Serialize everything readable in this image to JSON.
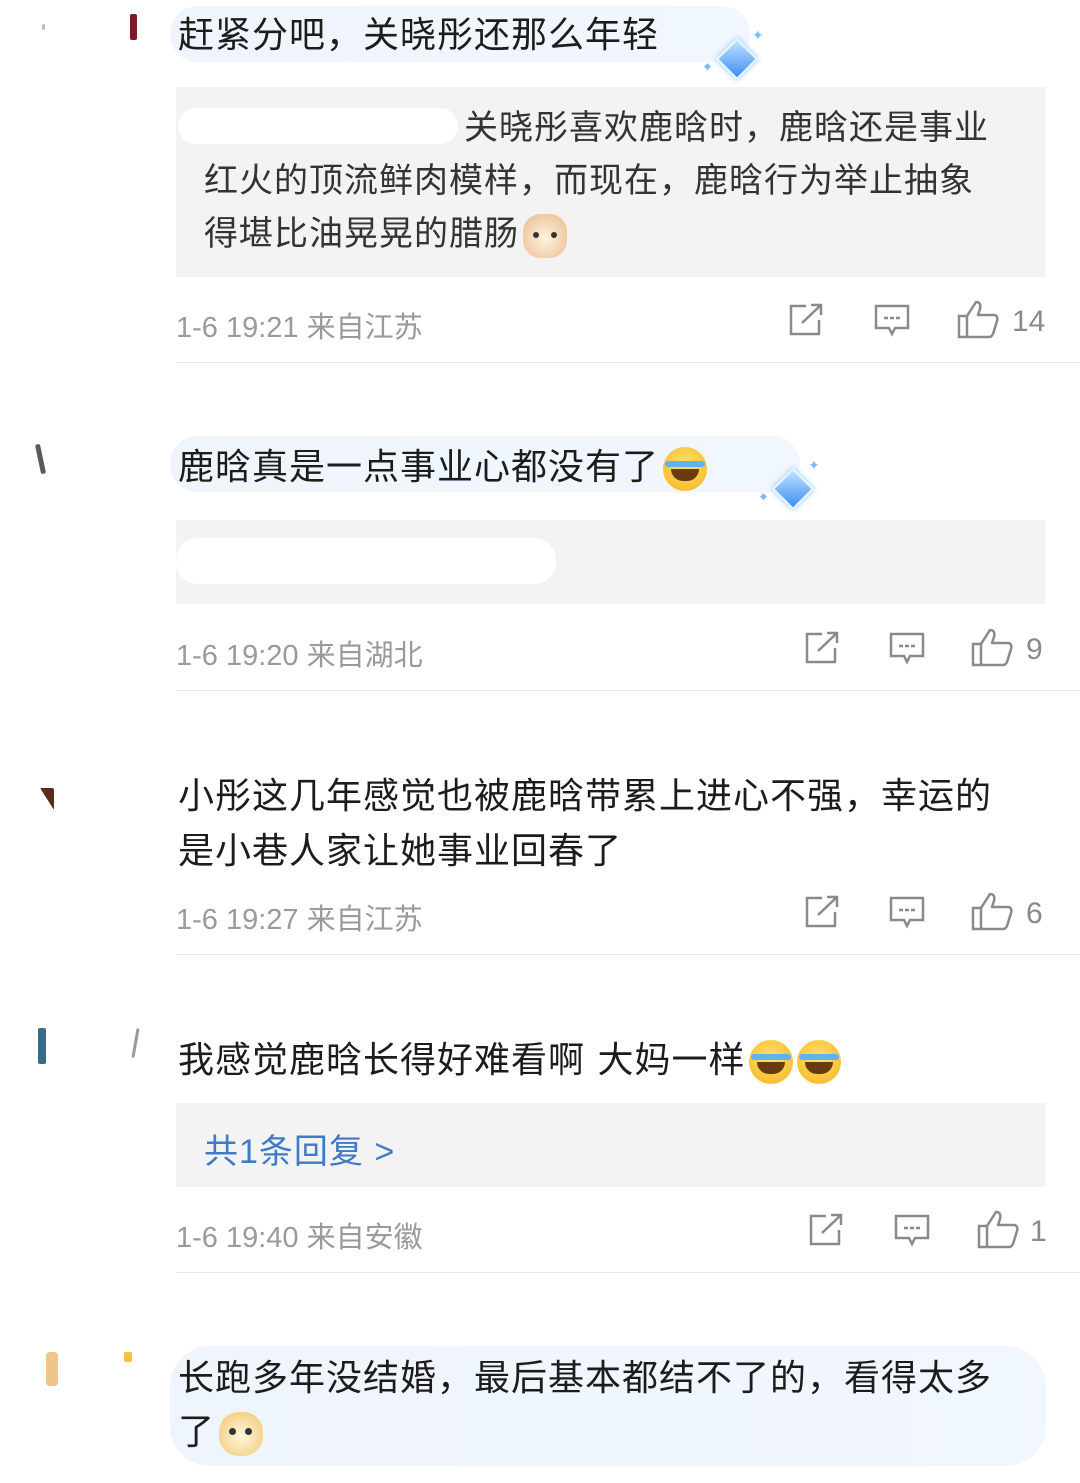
{
  "comments": [
    {
      "text": "赶紧分吧，关晓彤还那么年轻",
      "reply": [
        "关晓彤喜欢鹿晗时，鹿晗还是事业",
        "红火的顶流鲜肉模样，而现在，鹿晗行为举止抽象",
        "得堪比油晃晃的腊肠"
      ],
      "time": "1-6 19:21",
      "location": "来自江苏",
      "likes": "14"
    },
    {
      "text": "鹿晗真是一点事业心都没有了",
      "time": "1-6 19:20",
      "location": "来自湖北",
      "likes": "9"
    },
    {
      "text_lines": [
        "小彤这几年感觉也被鹿晗带累上进心不强，幸运的",
        "是小巷人家让她事业回春了"
      ],
      "time": "1-6 19:27",
      "location": "来自江苏",
      "likes": "6"
    },
    {
      "text": "我感觉鹿晗长得好难看啊 大妈一样",
      "more_replies": "共1条回复 >",
      "time": "1-6 19:40",
      "location": "来自安徽",
      "likes": "1"
    },
    {
      "text_lines": [
        "长跑多年没结婚，最后基本都结不了的，看得太多",
        "了"
      ]
    }
  ],
  "icons": {
    "share": "share-icon",
    "comment": "comment-icon",
    "like": "thumbs-up-icon",
    "badge": "diamond-badge-icon"
  },
  "colors": {
    "link": "#3f7bc4",
    "meta": "#9a9a9a",
    "reply_bg": "#f3f3f3"
  }
}
